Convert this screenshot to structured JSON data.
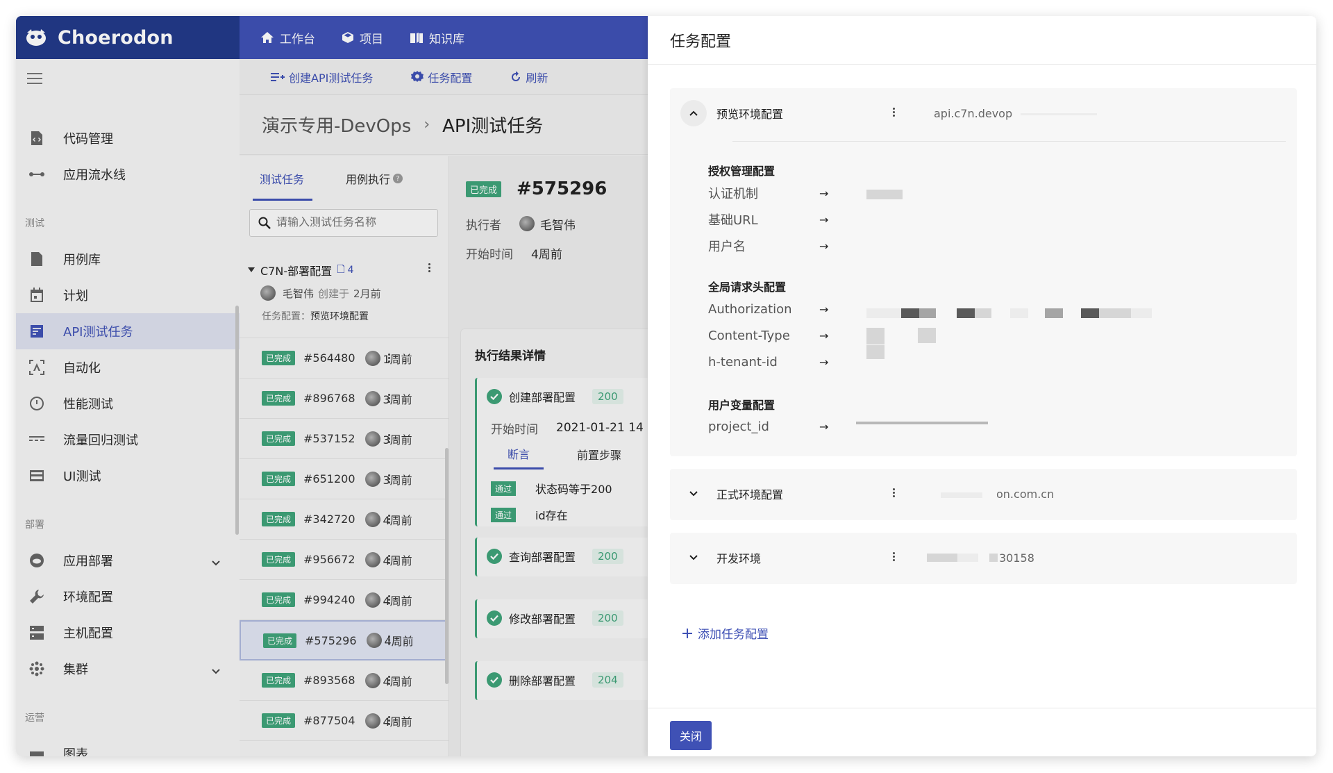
{
  "brand": {
    "name": "Choerodon"
  },
  "topnav": [
    {
      "label": "工作台",
      "icon": "home-icon"
    },
    {
      "label": "项目",
      "icon": "cube-icon"
    },
    {
      "label": "知识库",
      "icon": "book-icon"
    }
  ],
  "toolbar": {
    "create_label": "创建API测试任务",
    "config_label": "任务配置",
    "refresh_label": "刷新"
  },
  "breadcrumb": {
    "project": "演示专用-DevOps",
    "separator": "›",
    "current": "API测试任务"
  },
  "sidebar": {
    "items": [
      {
        "label": "代码管理"
      },
      {
        "label": "应用流水线"
      }
    ],
    "section_test": "测试",
    "test_items": [
      {
        "label": "用例库"
      },
      {
        "label": "计划"
      },
      {
        "label": "API测试任务"
      },
      {
        "label": "自动化"
      },
      {
        "label": "性能测试"
      },
      {
        "label": "流量回归测试"
      },
      {
        "label": "UI测试"
      }
    ],
    "section_deploy": "部署",
    "deploy_items": [
      {
        "label": "应用部署"
      },
      {
        "label": "环境配置"
      },
      {
        "label": "主机配置"
      },
      {
        "label": "集群"
      }
    ],
    "section_ops": "运营",
    "ops_items": [
      {
        "label": "图表"
      }
    ]
  },
  "list": {
    "tab_tasks": "测试任务",
    "tab_cases": "用例执行",
    "tab_cases_help": "?",
    "search_placeholder": "请输入测试任务名称",
    "group": {
      "name": "C7N-部署配置",
      "count": "4",
      "creator": "毛智伟",
      "created_label": "创建于",
      "created_time": "2月前",
      "config_label": "任务配置：",
      "config_value": "预览环境配置"
    },
    "status_done": "已完成",
    "tasks": [
      {
        "id": "#564480",
        "time": "1周前"
      },
      {
        "id": "#896768",
        "time": "3周前"
      },
      {
        "id": "#537152",
        "time": "3周前"
      },
      {
        "id": "#651200",
        "time": "3周前"
      },
      {
        "id": "#342720",
        "time": "4周前"
      },
      {
        "id": "#956672",
        "time": "4周前"
      },
      {
        "id": "#994240",
        "time": "4周前"
      },
      {
        "id": "#575296",
        "time": "4周前"
      },
      {
        "id": "#893568",
        "time": "4周前"
      },
      {
        "id": "#877504",
        "time": "4周前"
      }
    ]
  },
  "detail": {
    "status": "已完成",
    "id": "#575296",
    "executor_label": "执行者",
    "executor": "毛智伟",
    "start_label": "开始时间",
    "start_value": "4周前",
    "result_title": "执行结果详情",
    "steps": [
      {
        "name": "创建部署配置",
        "code": "200"
      },
      {
        "name": "查询部署配置",
        "code": "200"
      },
      {
        "name": "修改部署配置",
        "code": "200"
      },
      {
        "name": "删除部署配置",
        "code": "204"
      }
    ],
    "step_start_label": "开始时间",
    "step_start_value": "2021-01-21 14",
    "tab_assert": "断言",
    "tab_pre": "前置步骤",
    "pass_label": "通过",
    "asserts": [
      "状态码等于200",
      "id存在"
    ]
  },
  "drawer": {
    "title": "任务配置",
    "configs": [
      {
        "name": "预览环境配置",
        "url": "api.c7n.devop",
        "auth_section": "授权管理配置",
        "auth_keys": [
          "认证机制",
          "基础URL",
          "用户名"
        ],
        "header_section": "全局请求头配置",
        "header_keys": [
          "Authorization",
          "Content-Type",
          "h-tenant-id"
        ],
        "var_section": "用户变量配置",
        "var_keys": [
          "project_id"
        ],
        "arrow": "→"
      },
      {
        "name": "正式环境配置",
        "url": "on.com.cn"
      },
      {
        "name": "开发环境",
        "url": "30158"
      }
    ],
    "add_label": "添加任务配置",
    "close_label": "关闭"
  },
  "colors": {
    "primary": "#3f51b5",
    "brand_dark": "#233a8a",
    "success": "#3fa37a"
  }
}
